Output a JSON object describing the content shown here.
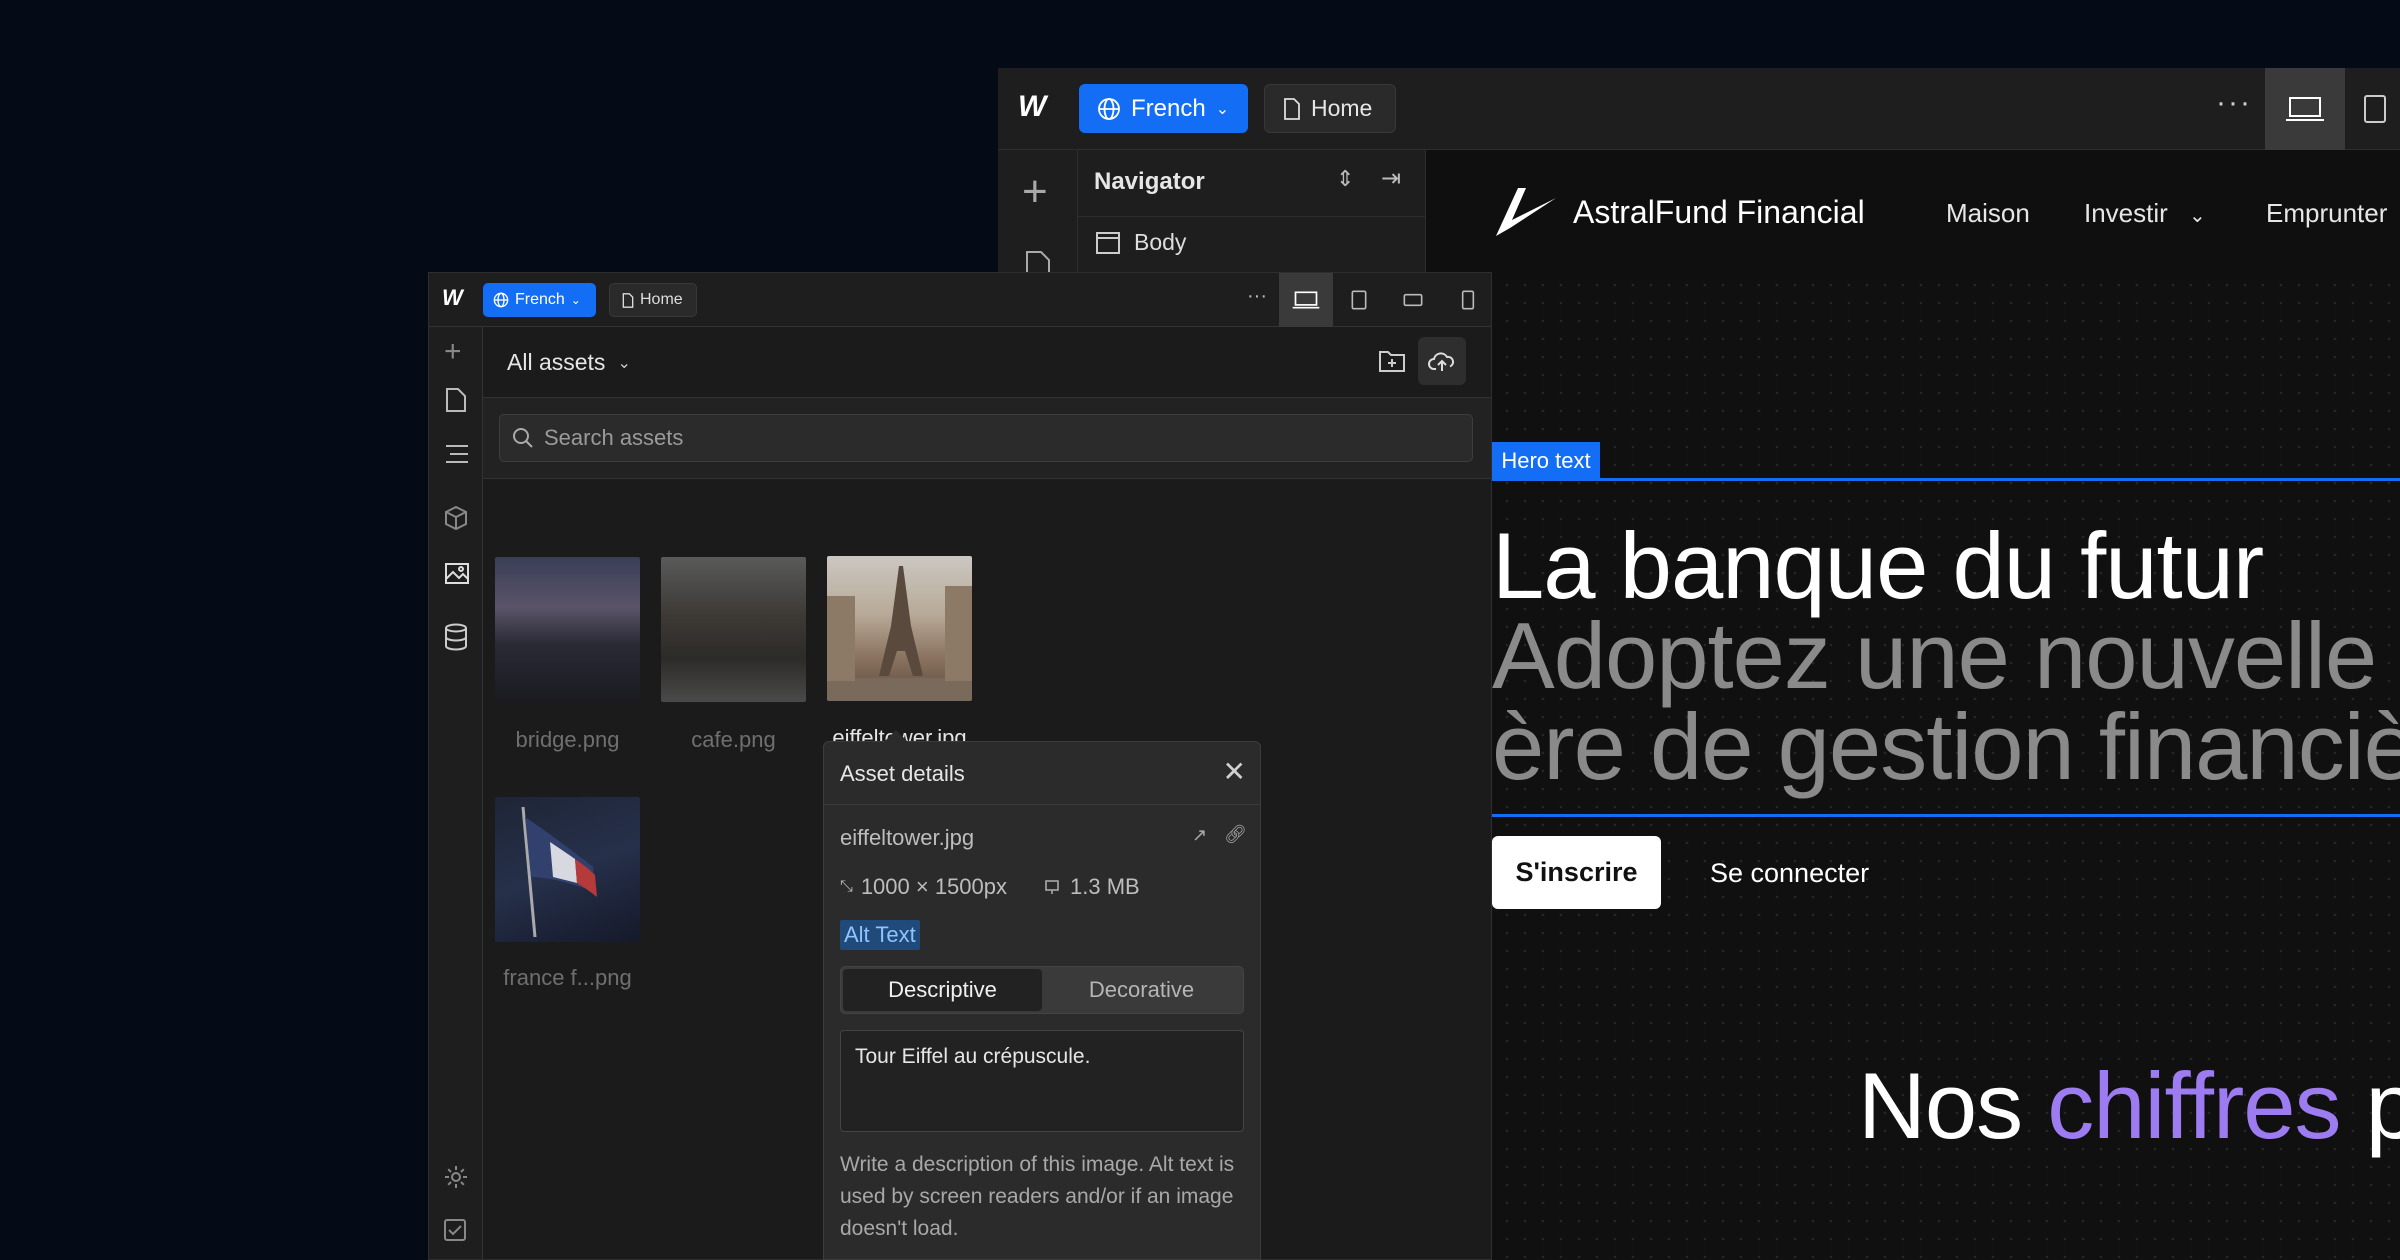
{
  "back_window": {
    "language_button": "French",
    "page_button": "Home",
    "more_menu": "···",
    "navigator": {
      "title": "Navigator",
      "body_item": "Body"
    }
  },
  "site": {
    "brand": "AstralFund Financial",
    "nav": {
      "maison": "Maison",
      "investir": "Investir",
      "emprunter": "Emprunter"
    },
    "hero_label": "Hero text",
    "hero_title": "La banque du futur",
    "hero_subtitle_line1": "Adoptez une nouvelle",
    "hero_subtitle_line2": "ère de gestion financièr",
    "cta_signup": "S'inscrire",
    "cta_login": "Se connecter",
    "stats_heading_prefix": "Nos ",
    "stats_heading_accent": "chiffres",
    "stats_heading_suffix": " p",
    "accent_color": "#9d7bf0",
    "selection_color": "#146ef5"
  },
  "front_window": {
    "language_button": "French",
    "page_button": "Home",
    "more_menu": "···",
    "assets": {
      "title": "All assets",
      "search_placeholder": "Search assets",
      "items": [
        {
          "name": "bridge.png"
        },
        {
          "name": "cafe.png"
        },
        {
          "name": "eiffeltower.jpg"
        },
        {
          "name": "france f...png"
        }
      ]
    },
    "asset_details": {
      "title": "Asset details",
      "filename": "eiffeltower.jpg",
      "dimensions": "1000 × 1500px",
      "file_size": "1.3 MB",
      "alt_label": "Alt Text",
      "mode_descriptive": "Descriptive",
      "mode_decorative": "Decorative",
      "selected_mode": "Descriptive",
      "alt_text_value": "Tour Eiffel au crépuscule.",
      "help_text": "Write a description of this image. Alt text is used by screen readers and/or if an image doesn't load."
    }
  }
}
